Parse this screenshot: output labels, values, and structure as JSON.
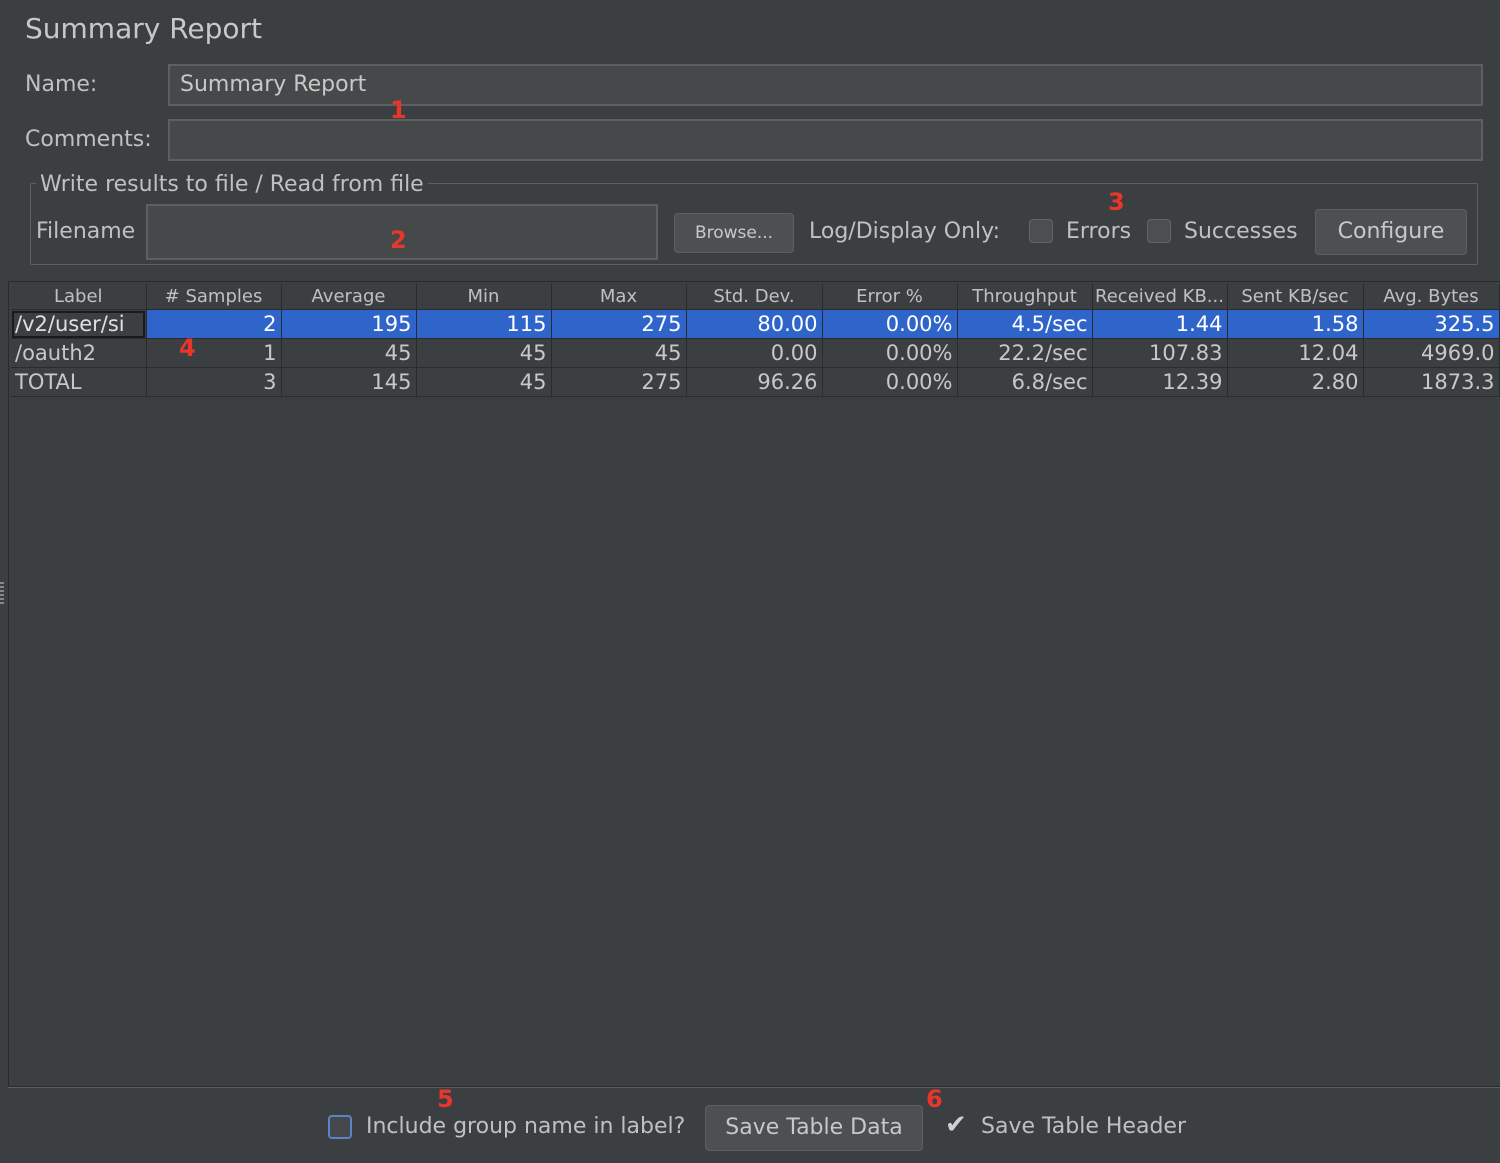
{
  "title": "Summary Report",
  "name": {
    "label": "Name:",
    "value": "Summary Report"
  },
  "comments": {
    "label": "Comments:",
    "value": ""
  },
  "file_group": {
    "title": "Write results to file / Read from file",
    "filename_label": "Filename",
    "filename_value": "",
    "browse_label": "Browse...",
    "log_display_label": "Log/Display Only:",
    "errors_label": "Errors",
    "errors_checked": false,
    "successes_label": "Successes",
    "successes_checked": false,
    "configure_label": "Configure"
  },
  "table": {
    "columns": [
      "Label",
      "# Samples",
      "Average",
      "Min",
      "Max",
      "Std. Dev.",
      "Error %",
      "Throughput",
      "Received KB...",
      "Sent KB/sec",
      "Avg. Bytes"
    ],
    "rows": [
      {
        "selected": true,
        "cells": [
          "/v2/user/si",
          "2",
          "195",
          "115",
          "275",
          "80.00",
          "0.00%",
          "4.5/sec",
          "1.44",
          "1.58",
          "325.5"
        ]
      },
      {
        "selected": false,
        "cells": [
          "/oauth2",
          "1",
          "45",
          "45",
          "45",
          "0.00",
          "0.00%",
          "22.2/sec",
          "107.83",
          "12.04",
          "4969.0"
        ]
      },
      {
        "selected": false,
        "cells": [
          "TOTAL",
          "3",
          "145",
          "45",
          "275",
          "96.26",
          "0.00%",
          "6.8/sec",
          "12.39",
          "2.80",
          "1873.3"
        ]
      }
    ]
  },
  "footer": {
    "include_group_label": "Include group name in label?",
    "include_group_checked": false,
    "save_table_data_label": "Save Table Data",
    "save_table_header_label": "Save Table Header",
    "save_table_header_checked": true
  },
  "annotations": [
    "1",
    "2",
    "3",
    "4",
    "5",
    "6"
  ],
  "colors": {
    "background": "#3c3f41",
    "selection": "#2f65ca",
    "annotation": "#e8362b",
    "field": "#45494a"
  }
}
